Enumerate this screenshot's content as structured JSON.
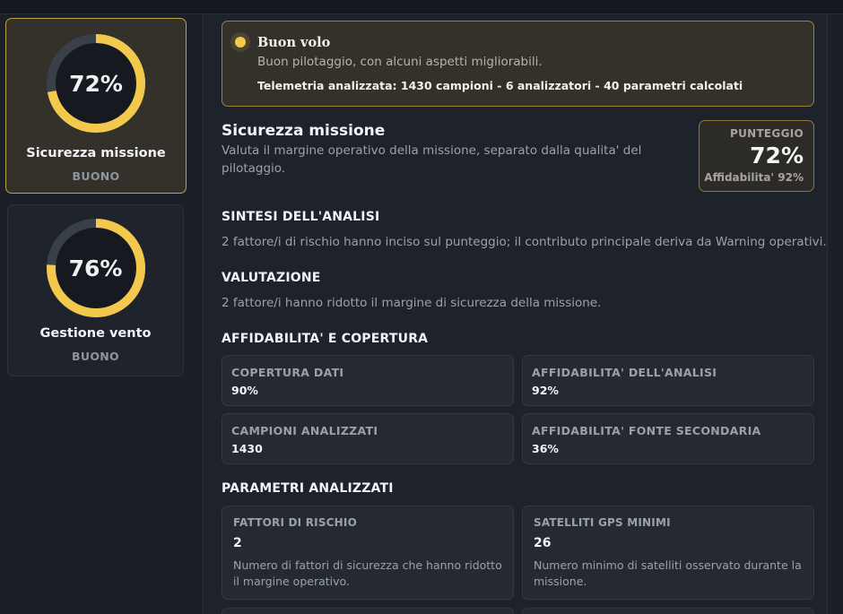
{
  "gauges": [
    {
      "value_label": "72%",
      "value": 0.72,
      "name": "Sicurezza missione",
      "level": "BUONO"
    },
    {
      "value_label": "76%",
      "value": 0.76,
      "name": "Gestione vento",
      "level": "BUONO"
    }
  ],
  "banner": {
    "title": "Buon volo",
    "subtitle": "Buon pilotaggio, con alcuni aspetti migliorabili.",
    "telemetry": "Telemetria analizzata: 1430 campioni - 6 analizzatori - 40 parametri calcolati"
  },
  "section": {
    "title": "Sicurezza missione",
    "description": "Valuta il margine operativo della missione, separato dalla qualita' del pilotaggio."
  },
  "score": {
    "label": "PUNTEGGIO",
    "value": "72%",
    "reliability": "Affidabilita' 92%"
  },
  "summary": {
    "heading": "SINTESI DELL'ANALISI",
    "text": "2 fattore/i di rischio hanno inciso sul punteggio; il contributo principale deriva da Warning operativi."
  },
  "evaluation": {
    "heading": "VALUTAZIONE",
    "text": "2 fattore/i hanno ridotto il margine di sicurezza della missione."
  },
  "coverage": {
    "heading": "AFFIDABILITA' E COPERTURA",
    "metrics": [
      {
        "label": "COPERTURA DATI",
        "value": "90%"
      },
      {
        "label": "AFFIDABILITA' DELL'ANALISI",
        "value": "92%"
      },
      {
        "label": "CAMPIONI ANALIZZATI",
        "value": "1430"
      },
      {
        "label": "AFFIDABILITA' FONTE SECONDARIA",
        "value": "36%"
      }
    ]
  },
  "parameters": {
    "heading": "PARAMETRI ANALIZZATI",
    "items": [
      {
        "label": "FATTORI DI RISCHIO",
        "value": "2",
        "description": "Numero di fattori di sicurezza che hanno ridotto il margine operativo."
      },
      {
        "label": "SATELLITI GPS MINIMI",
        "value": "26",
        "description": "Numero minimo di satelliti osservato durante la missione."
      }
    ]
  },
  "colors": {
    "accent": "#f2c94c",
    "track": "#3a4049"
  }
}
